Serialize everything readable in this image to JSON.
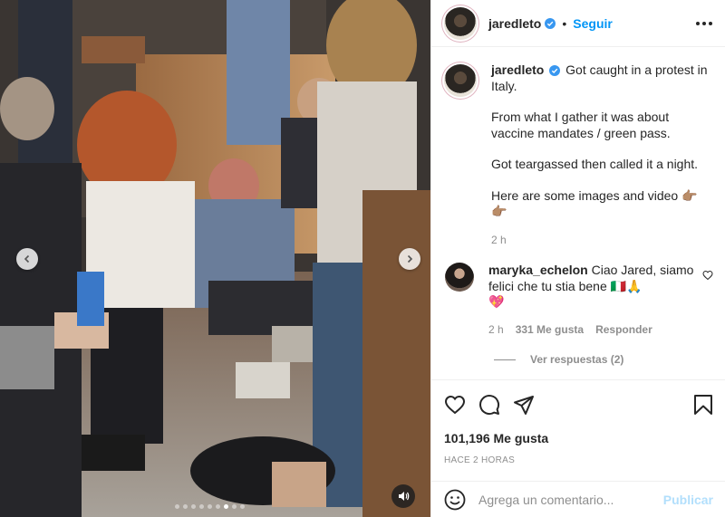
{
  "post": {
    "username": "jaredleto",
    "follow_label": "Seguir",
    "separator": "•"
  },
  "caption": {
    "username": "jaredleto",
    "line1": "Got caught in a protest in Italy.",
    "line2": "From what I gather it was about vaccine mandates / green pass.",
    "line3": "Got teargassed then called it a night.",
    "line4": "Here are some images and video 👉🏽👉🏽",
    "time": "2 h"
  },
  "comment": {
    "username": "maryka_echelon",
    "text": "Ciao Jared, siamo felici che tu stia bene 🇮🇹🙏",
    "text2": "💖",
    "time": "2 h",
    "likes": "331 Me gusta",
    "reply_label": "Responder",
    "view_replies": "Ver respuestas (2)"
  },
  "stats": {
    "likes": "101,196 Me gusta",
    "posted": "HACE 2 HORAS"
  },
  "add_comment": {
    "placeholder": "Agrega un comentario...",
    "publish_label": "Publicar"
  },
  "carousel": {
    "slide_count": 9,
    "active_index": 6
  },
  "icons": {
    "like": "heart-icon",
    "comment": "comment-icon",
    "share": "paper-plane-icon",
    "save": "bookmark-icon",
    "emoji": "smiley-icon",
    "more": "more-options-icon",
    "audio": "speaker-icon",
    "verified": "verified-badge-icon"
  },
  "colors": {
    "accent": "#0095f6",
    "verified": "#3897f0",
    "muted_text": "#8e8e8e",
    "publish_disabled": "#b2dffc"
  }
}
